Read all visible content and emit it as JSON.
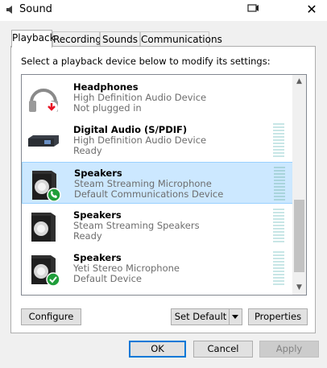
{
  "window": {
    "title": "Sound"
  },
  "tabs": [
    {
      "label": "Playback",
      "active": true
    },
    {
      "label": "Recording",
      "active": false
    },
    {
      "label": "Sounds",
      "active": false
    },
    {
      "label": "Communications",
      "active": false
    }
  ],
  "instruction": "Select a playback device below to modify its settings:",
  "devices": [
    {
      "name": "Headphones",
      "subtitle": "High Definition Audio Device",
      "status": "Not plugged in",
      "icon": "headphones-icon",
      "badge": "unplugged-red-arrow",
      "selected": false
    },
    {
      "name": "Digital Audio (S/PDIF)",
      "subtitle": "High Definition Audio Device",
      "status": "Ready",
      "icon": "digital-audio-icon",
      "badge": "none",
      "selected": false
    },
    {
      "name": "Speakers",
      "subtitle": "Steam Streaming Microphone",
      "status": "Default Communications Device",
      "icon": "speaker-icon",
      "badge": "phone-green",
      "selected": true
    },
    {
      "name": "Speakers",
      "subtitle": "Steam Streaming Speakers",
      "status": "Ready",
      "icon": "speaker-icon",
      "badge": "none",
      "selected": false
    },
    {
      "name": "Speakers",
      "subtitle": "Yeti Stereo Microphone",
      "status": "Default Device",
      "icon": "speaker-icon",
      "badge": "check-green",
      "selected": false
    }
  ],
  "buttons": {
    "configure": "Configure",
    "set_default": "Set Default",
    "properties": "Properties",
    "ok": "OK",
    "cancel": "Cancel",
    "apply": "Apply"
  },
  "colors": {
    "selected_bg": "#cce8ff",
    "selected_border": "#99d1ff",
    "ok_border": "#0078d7",
    "badge_green": "#1f9e3a",
    "badge_red": "#e81123",
    "meter": "#c8e6e6"
  }
}
